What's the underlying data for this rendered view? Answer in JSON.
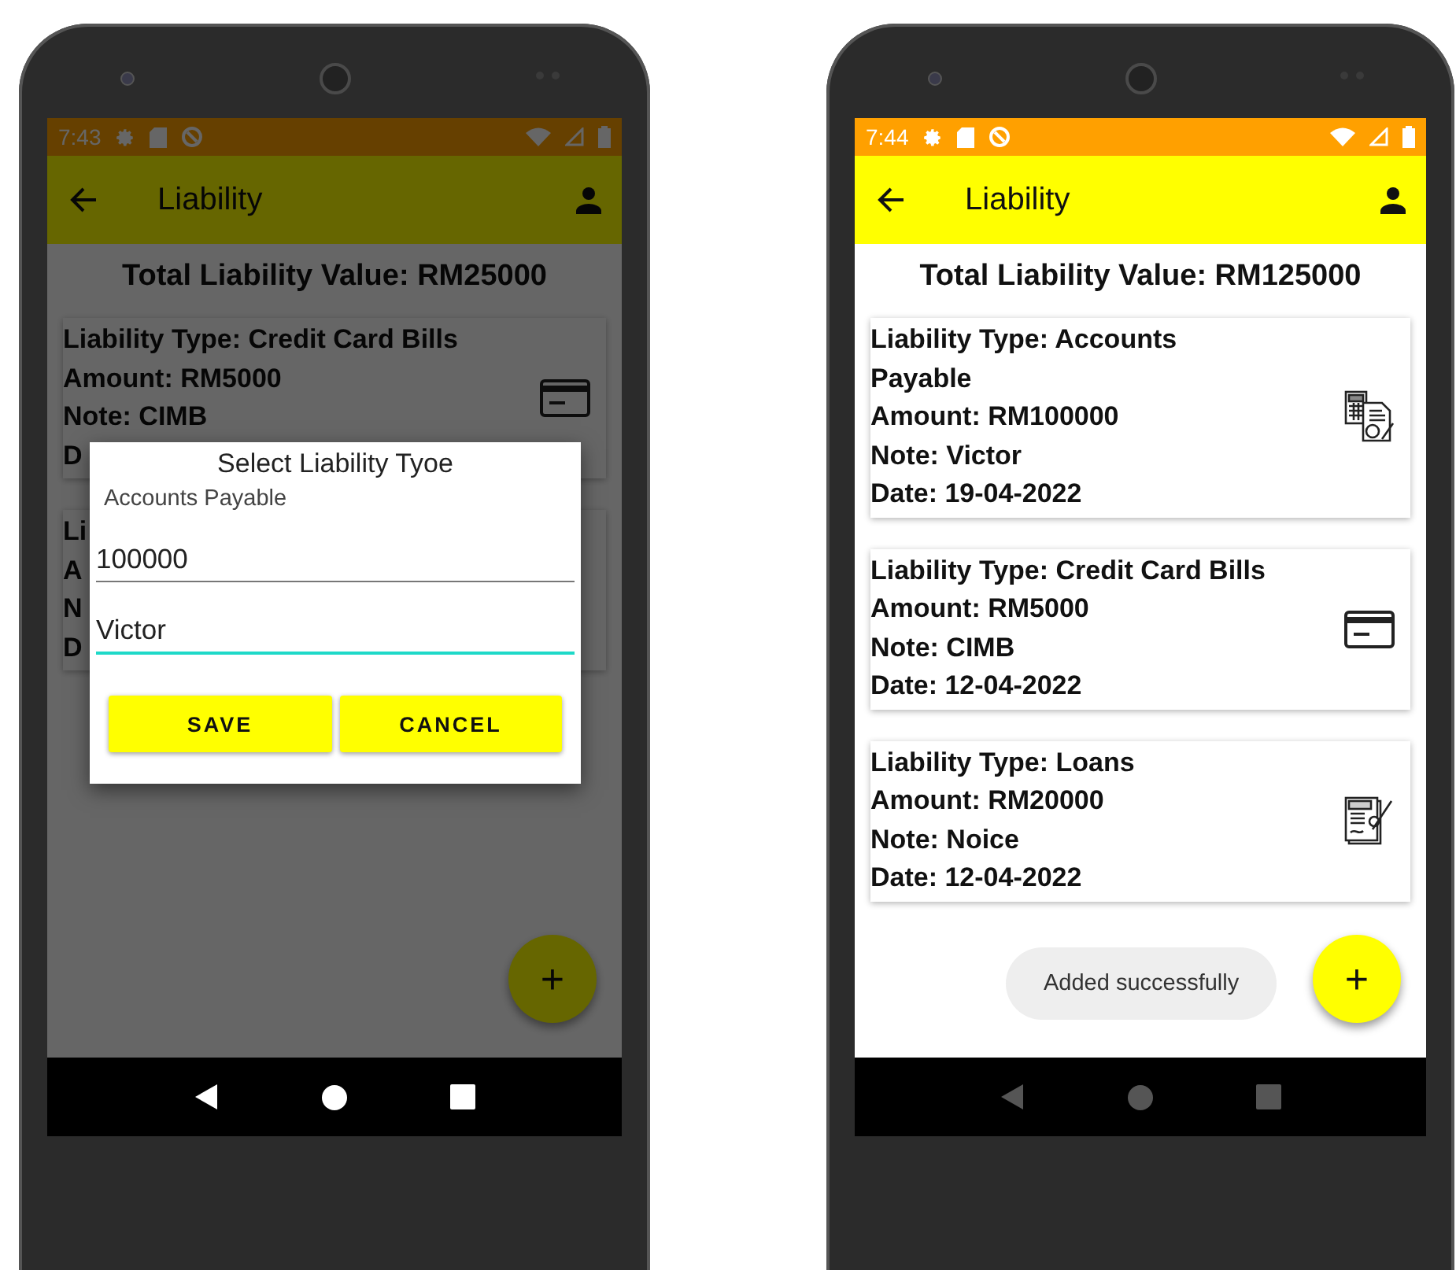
{
  "phones": [
    {
      "status_bar": {
        "time": "7:43"
      },
      "app_bar": {
        "title": "Liability"
      },
      "total": "Total Liability Value: RM25000",
      "cards": [
        {
          "kind": "credit_card",
          "lines": [
            "Liability Type: Credit Card Bills",
            "Amount: RM5000",
            "Note: CIMB",
            "D"
          ]
        },
        {
          "kind": "hidden",
          "lines": [
            "Li",
            "A",
            "N",
            "D"
          ]
        }
      ],
      "fab": {
        "label": "+"
      },
      "dialog": {
        "title": "Select Liability Tyoe",
        "selection": "Accounts Payable",
        "fields": [
          {
            "value": "100000",
            "focused": false
          },
          {
            "value": "Victor",
            "focused": true
          }
        ],
        "buttons": [
          "SAVE",
          "CANCEL"
        ]
      }
    },
    {
      "status_bar": {
        "time": "7:44"
      },
      "app_bar": {
        "title": "Liability"
      },
      "total": "Total Liability Value: RM125000",
      "cards": [
        {
          "kind": "accounts_payable",
          "lines": [
            "Liability Type: Accounts Payable",
            "Amount: RM100000",
            "Note: Victor",
            "Date: 19-04-2022"
          ]
        },
        {
          "kind": "credit_card",
          "lines": [
            "Liability Type: Credit Card Bills",
            "Amount: RM5000",
            "Note: CIMB",
            "Date: 12-04-2022"
          ]
        },
        {
          "kind": "loan",
          "lines": [
            "Liability Type: Loans",
            "Amount: RM20000",
            "Note: Noice",
            "Date: 12-04-2022"
          ]
        }
      ],
      "fab": {
        "label": "+"
      },
      "toast": "Added successfully"
    }
  ]
}
